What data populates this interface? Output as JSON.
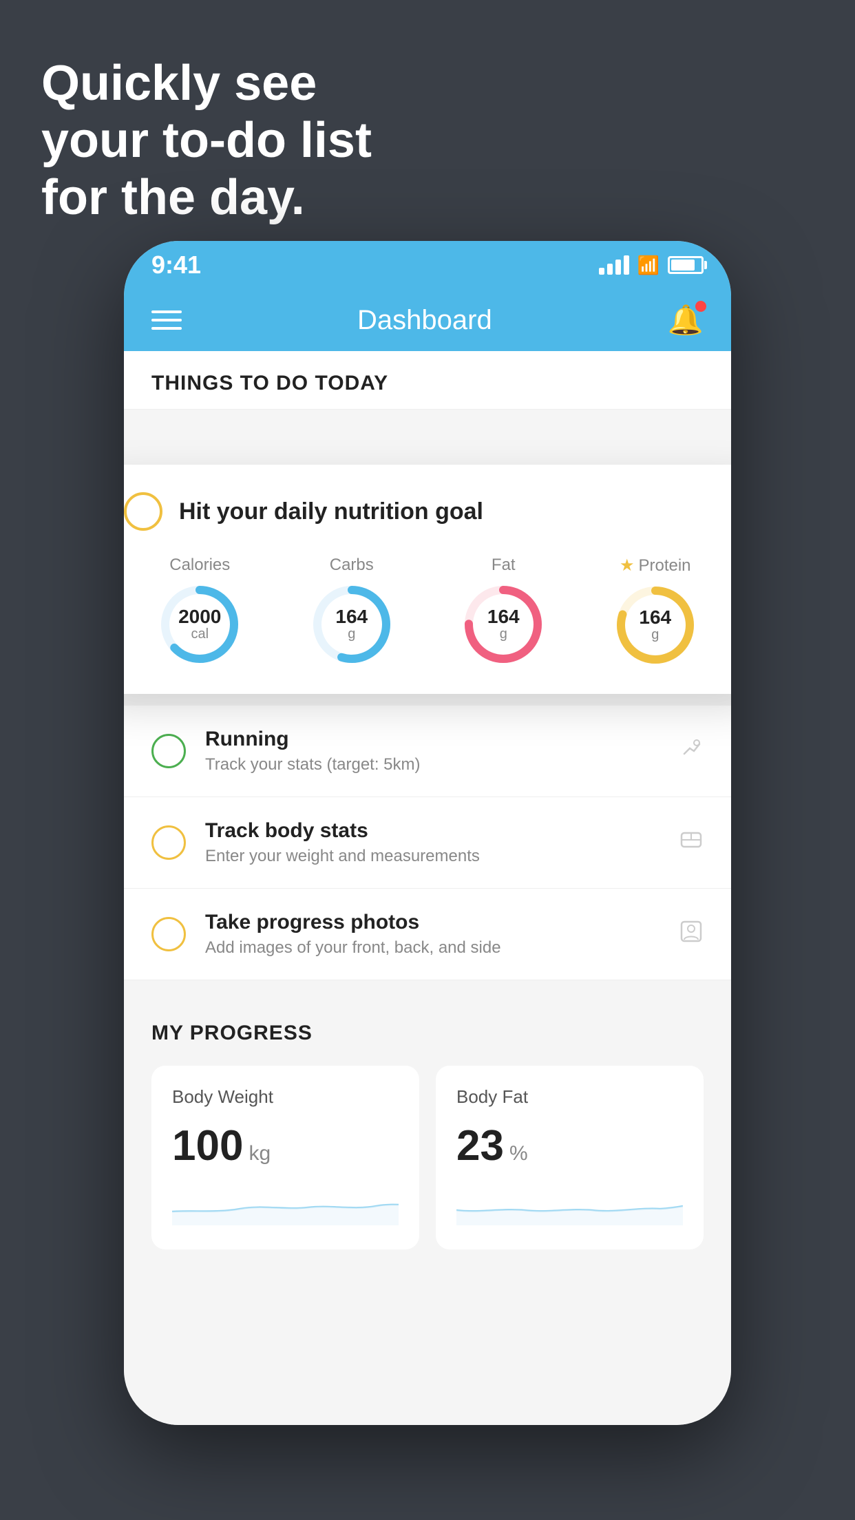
{
  "headline": {
    "line1": "Quickly see",
    "line2": "your to-do list",
    "line3": "for the day."
  },
  "status_bar": {
    "time": "9:41"
  },
  "nav": {
    "title": "Dashboard"
  },
  "things_today": {
    "section_title": "THINGS TO DO TODAY"
  },
  "nutrition_card": {
    "title": "Hit your daily nutrition goal",
    "stats": [
      {
        "label": "Calories",
        "value": "2000",
        "unit": "cal",
        "color": "#4db8e8",
        "progress": 0.65
      },
      {
        "label": "Carbs",
        "value": "164",
        "unit": "g",
        "color": "#4db8e8",
        "progress": 0.55
      },
      {
        "label": "Fat",
        "value": "164",
        "unit": "g",
        "color": "#f06080",
        "progress": 0.75
      },
      {
        "label": "Protein",
        "value": "164",
        "unit": "g",
        "color": "#f0c040",
        "progress": 0.8,
        "starred": true
      }
    ]
  },
  "todo_items": [
    {
      "name": "Running",
      "desc": "Track your stats (target: 5km)",
      "circle_color": "green",
      "icon": "👟"
    },
    {
      "name": "Track body stats",
      "desc": "Enter your weight and measurements",
      "circle_color": "yellow",
      "icon": "⚖️"
    },
    {
      "name": "Take progress photos",
      "desc": "Add images of your front, back, and side",
      "circle_color": "yellow",
      "icon": "👤"
    }
  ],
  "progress": {
    "section_title": "MY PROGRESS",
    "cards": [
      {
        "title": "Body Weight",
        "value": "100",
        "unit": "kg"
      },
      {
        "title": "Body Fat",
        "value": "23",
        "unit": "%"
      }
    ]
  }
}
